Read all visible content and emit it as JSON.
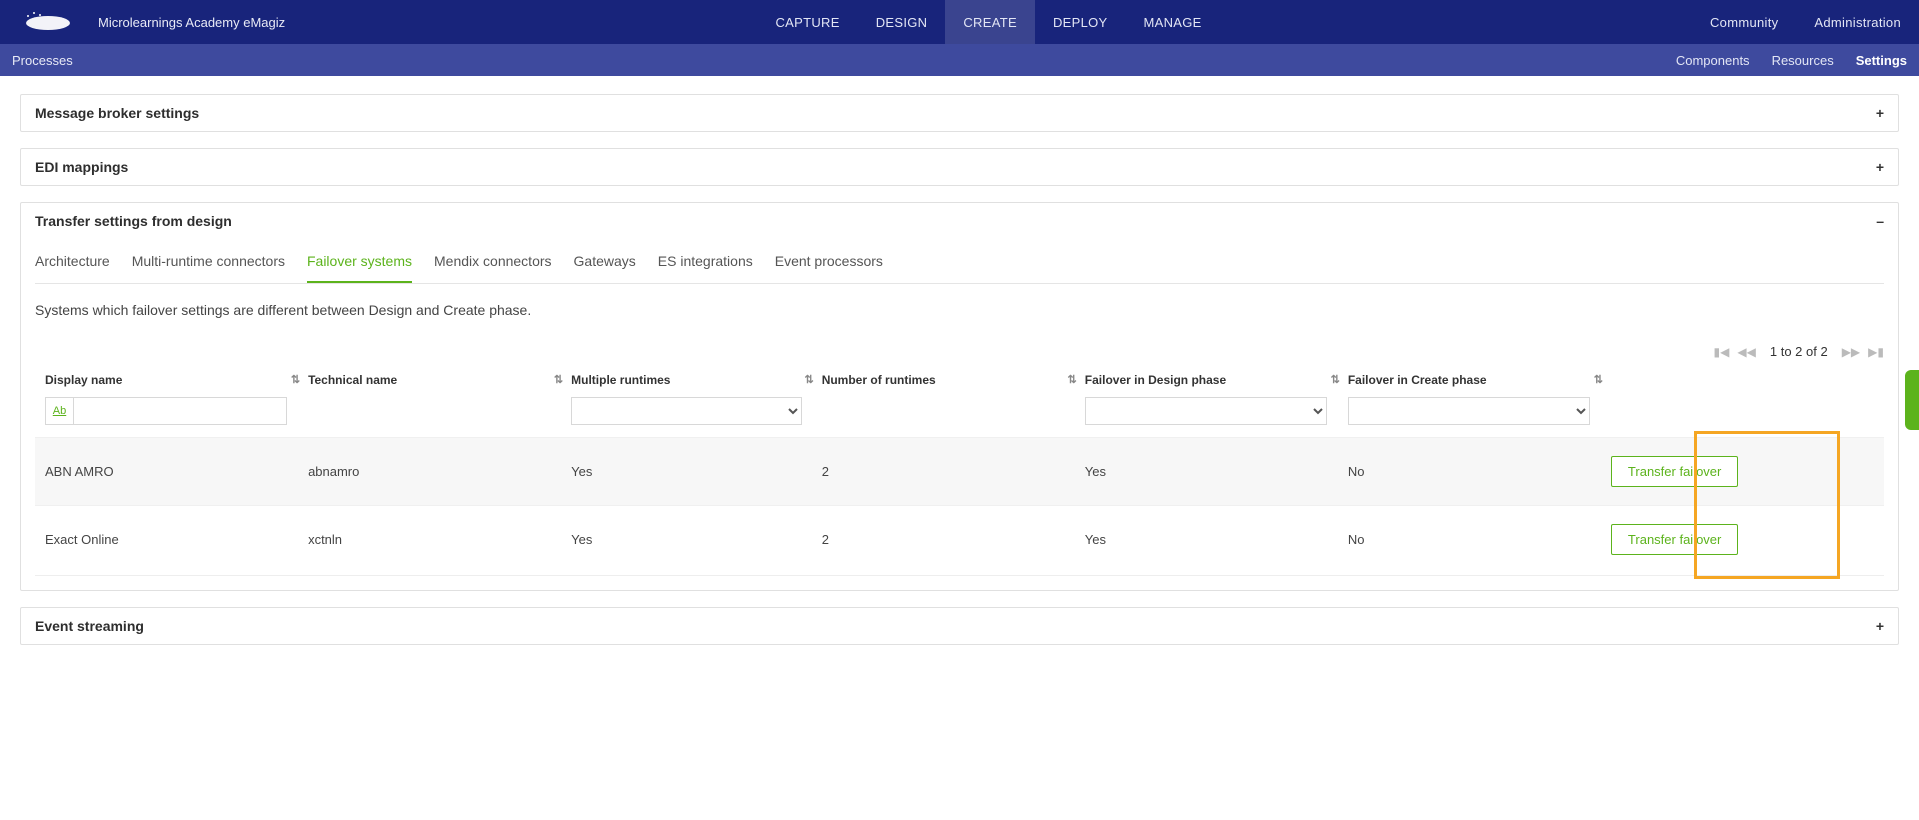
{
  "brand": "Microlearnings Academy eMagiz",
  "nav": {
    "capture": "CAPTURE",
    "design": "DESIGN",
    "create": "CREATE",
    "deploy": "DEPLOY",
    "manage": "MANAGE",
    "community": "Community",
    "administration": "Administration"
  },
  "subbar": {
    "left": "Processes",
    "components": "Components",
    "resources": "Resources",
    "settings": "Settings"
  },
  "panels": {
    "broker": "Message broker settings",
    "edi": "EDI mappings",
    "transfer": "Transfer settings from design",
    "event": "Event streaming"
  },
  "expand_plus": "+",
  "expand_minus": "–",
  "tabs": {
    "architecture": "Architecture",
    "multiruntime": "Multi-runtime connectors",
    "failover": "Failover systems",
    "mendix": "Mendix connectors",
    "gateways": "Gateways",
    "es": "ES integrations",
    "event": "Event processors"
  },
  "description": "Systems which failover settings are different between Design and Create phase.",
  "pager": "1 to 2 of 2",
  "columns": {
    "display": "Display name",
    "technical": "Technical name",
    "multiple": "Multiple runtimes",
    "number": "Number of runtimes",
    "fdesign": "Failover in Design phase",
    "fcreate": "Failover in Create phase"
  },
  "filter_ab": "Ab",
  "rows": [
    {
      "display": "ABN AMRO",
      "technical": "abnamro",
      "multiple": "Yes",
      "number": "2",
      "fdesign": "Yes",
      "fcreate": "No",
      "action": "Transfer failover"
    },
    {
      "display": "Exact Online",
      "technical": "xctnln",
      "multiple": "Yes",
      "number": "2",
      "fdesign": "Yes",
      "fcreate": "No",
      "action": "Transfer failover"
    }
  ]
}
